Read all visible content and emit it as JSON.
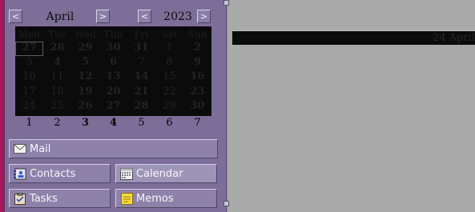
{
  "calendar": {
    "month": "April",
    "year": "2023",
    "prev": "<",
    "next": ">",
    "weekdays": [
      "Mon",
      "Tue",
      "Wed",
      "Thu",
      "Fri",
      "Sat",
      "Sun"
    ],
    "weeks": [
      [
        "27",
        "28",
        "29",
        "30",
        "31",
        "1",
        "2"
      ],
      [
        "3",
        "4",
        "5",
        "6",
        "7",
        "8",
        "9"
      ],
      [
        "10",
        "11",
        "12",
        "13",
        "14",
        "15",
        "16"
      ],
      [
        "17",
        "18",
        "19",
        "20",
        "21",
        "22",
        "23"
      ],
      [
        "24",
        "25",
        "26",
        "27",
        "28",
        "29",
        "30"
      ]
    ],
    "bold_days": [
      [
        0,
        0
      ],
      [
        0,
        1
      ],
      [
        0,
        2
      ],
      [
        0,
        3
      ],
      [
        0,
        4
      ],
      [
        1,
        1
      ],
      [
        1,
        2
      ],
      [
        1,
        3
      ],
      [
        2,
        2
      ],
      [
        2,
        3
      ],
      [
        2,
        4
      ],
      [
        3,
        2
      ],
      [
        3,
        3
      ],
      [
        3,
        4
      ],
      [
        4,
        2
      ],
      [
        4,
        3
      ],
      [
        4,
        4
      ],
      [
        4,
        6
      ],
      [
        0,
        6
      ],
      [
        1,
        6
      ],
      [
        2,
        6
      ],
      [
        3,
        6
      ]
    ],
    "next_month_row": [
      "1",
      "2",
      "3",
      "4",
      "5",
      "6",
      "7"
    ],
    "next_month_bold": [
      2,
      3
    ]
  },
  "navigator": {
    "mail": "Mail",
    "contacts": "Contacts",
    "calendar": "Calendar",
    "tasks": "Tasks",
    "memos": "Memos"
  },
  "dayview": {
    "date_label": "24 April"
  },
  "colors": {
    "accent": "#a6195f",
    "sidebar": "#7c6e98",
    "button": "#8e82ab"
  }
}
